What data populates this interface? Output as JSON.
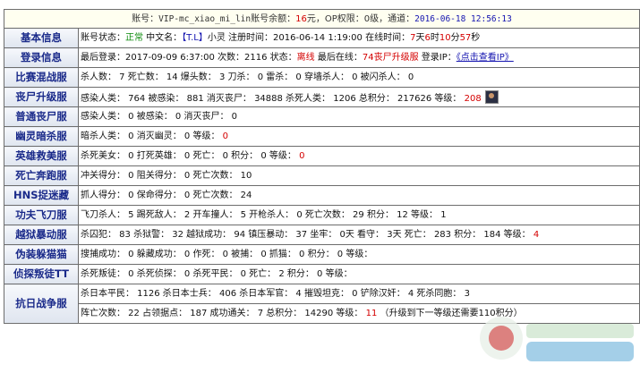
{
  "header": {
    "account_label": "账号：",
    "account": "VIP-mc_xiao_mi_lin",
    "balance_label": "账号余额：",
    "balance": "16",
    "balance_unit": "元，OP权限：",
    "op": "0级",
    "channel_label": "，通道：",
    "datetime": "2016-06-18 12:56:13"
  },
  "rows": {
    "basic": {
      "label": "基本信息",
      "status_l": "账号状态：",
      "status": "正常",
      "cname_l": " 中文名：",
      "tag": "【T.L】",
      "cname": "小灵",
      "reg_l": " 注册时间：",
      "reg": "2016-06-14 1:19:00",
      "online_l": " 在线时间：",
      "d": "7",
      "d_u": "天",
      "h": "6",
      "h_u": "时",
      "m": "10",
      "m_u": "分",
      "s": "57",
      "s_u": "秒"
    },
    "login": {
      "label": "登录信息",
      "last_l": "最后登录：",
      "last": "2017-09-09 6:37:00",
      "cnt_l": " 次数：",
      "cnt": "2116",
      "st_l": " 状态：",
      "st": "离线",
      "lon_l": " 最后在线：",
      "lon": "74丧尸升级服",
      "ip_l": " 登录IP：",
      "ip": "《点击查看IP》"
    },
    "match": {
      "label": "比赛混战服",
      "text": "杀人数： 7 死亡数： 14 爆头数： 3 刀杀： 0 雷杀： 0 穿墙杀人： 0 被闪杀人： 0"
    },
    "zombie_up": {
      "label": "丧尸升级服",
      "t1": "感染人类： 764 被感染： 881 消灭丧尸： 34888 杀死人类： 1206 总积分： 217626 等级：",
      "lvl": "208"
    },
    "zombie": {
      "label": "普通丧尸服",
      "text": "感染人类： 0 被感染： 0 消灭丧尸： 0"
    },
    "ghost": {
      "label": "幽灵暗杀服",
      "t1": "暗杀人类： 0 消灭幽灵： 0 等级：",
      "lvl": "0"
    },
    "hero": {
      "label": "英雄救美服",
      "t1": "杀死美女： 0 打死英雄： 0 死亡： 0 积分： 0 等级：",
      "lvl": "0"
    },
    "death": {
      "label": "死亡奔跑服",
      "text": "冲关得分： 0 阻关得分： 0 死亡次数： 10"
    },
    "hns": {
      "label": "HNS捉迷藏",
      "text": "抓人得分： 0 保命得分： 0 死亡次数： 24"
    },
    "kungfu": {
      "label": "功夫飞刀服",
      "text": "飞刀杀人： 5 踢死敌人： 2 开车撞人： 5 开枪杀人： 0 死亡次数： 29 积分： 12 等级： 1"
    },
    "jail": {
      "label": "越狱暴动服",
      "t1": "杀囚犯： 83 杀狱警： 32 越狱成功： 94 镇压暴动： 37 坐牢： 0天 看守： 3天 死亡： 283 积分： 184 等级：",
      "lvl": "4"
    },
    "hide": {
      "label": "伪装躲猫猫",
      "text": "搜捕成功： 0 躲藏成功： 0 作死： 0 被捕： 0 抓猫： 0 积分： 0 等级："
    },
    "spy": {
      "label": "侦探叛徒TT",
      "text": "杀死叛徒： 0 杀死侦探： 0 杀死平民： 0 死亡： 2 积分： 0 等级："
    },
    "war": {
      "label": "抗日战争服",
      "line1": "杀日本平民： 1126 杀日本士兵： 406 杀日本军官： 4 摧毁坦克： 0 铲除汉奸： 4 死杀同胞： 3",
      "line2": "阵亡次数： 22 占领据点： 187 成功通关： 7 总积分： 14290 等级：",
      "lvl": "11",
      "note": "（升级到下一等级还需要110积分）"
    }
  },
  "colors": {
    "label_text": "#1a2a8a",
    "accent_red": "#d40000",
    "green": "#0b8a0b",
    "link": "#1515b0"
  }
}
